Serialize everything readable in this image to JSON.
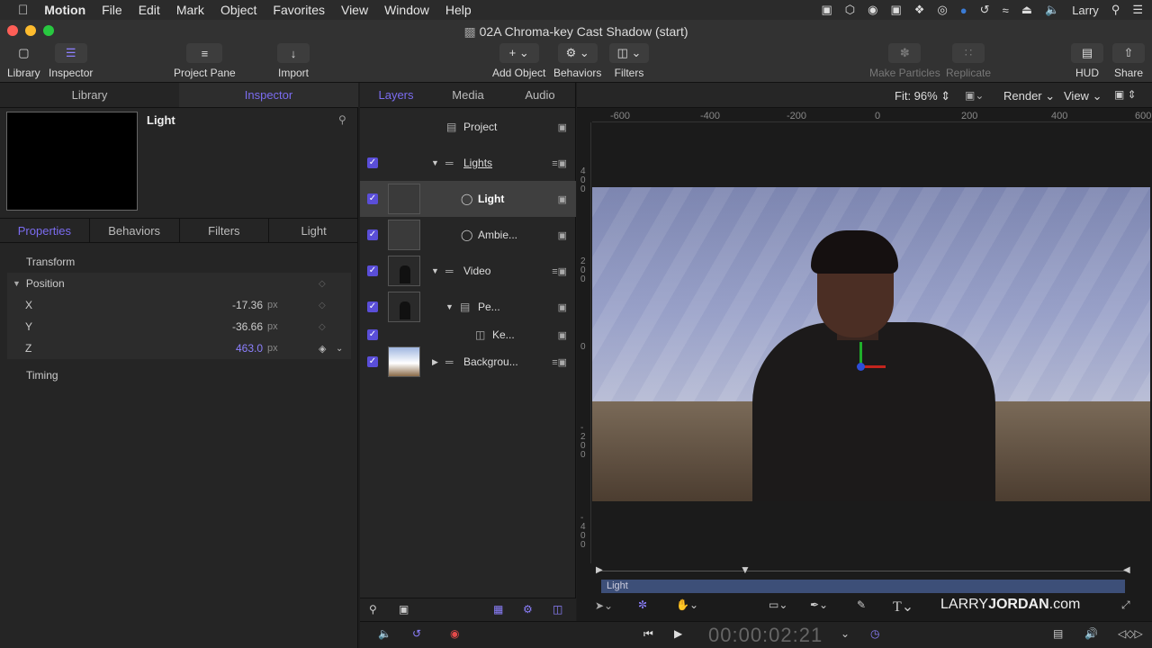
{
  "menubar": {
    "apple": "",
    "app_name": "Motion",
    "items": [
      "File",
      "Edit",
      "Mark",
      "Object",
      "Favorites",
      "View",
      "Window",
      "Help"
    ],
    "user": "Larry"
  },
  "window": {
    "title": "02A Chroma-key Cast Shadow (start)"
  },
  "toolbar": {
    "library": "Library",
    "inspector": "Inspector",
    "project_pane": "Project Pane",
    "import": "Import",
    "add_object": "Add Object",
    "behaviors": "Behaviors",
    "filters": "Filters",
    "make_particles": "Make Particles",
    "replicate": "Replicate",
    "hud": "HUD",
    "share": "Share"
  },
  "left": {
    "tabs": [
      "Library",
      "Inspector"
    ],
    "item_name": "Light",
    "subtabs": [
      "Properties",
      "Behaviors",
      "Filters",
      "Light"
    ],
    "sections": {
      "transform": "Transform",
      "position": "Position",
      "timing": "Timing"
    },
    "position": [
      {
        "axis": "X",
        "value": "-17.36",
        "unit": "px"
      },
      {
        "axis": "Y",
        "value": "-36.66",
        "unit": "px"
      },
      {
        "axis": "Z",
        "value": "463.0",
        "unit": "px"
      }
    ]
  },
  "layers": {
    "tabs": [
      "Layers",
      "Media",
      "Audio"
    ],
    "rows": [
      {
        "name": "Project"
      },
      {
        "name": "Lights"
      },
      {
        "name": "Light"
      },
      {
        "name": "Ambie..."
      },
      {
        "name": "Video"
      },
      {
        "name": "Pe..."
      },
      {
        "name": "Ke..."
      },
      {
        "name": "Backgrou..."
      }
    ]
  },
  "viewer": {
    "fit": "Fit: 96%",
    "render": "Render",
    "view": "View",
    "ruler_h": [
      "-600",
      "-400",
      "-200",
      "0",
      "200",
      "400",
      "600"
    ],
    "ruler_v": [
      "4\n0\n0",
      "2\n0\n0",
      "0",
      "-\n2\n0\n0",
      "-\n4\n0\n0"
    ]
  },
  "timeline": {
    "bar_label": "Light",
    "timecode": "00:00:02:21",
    "watermark_a": "LARRY",
    "watermark_b": "JORDAN",
    "watermark_c": ".com"
  }
}
